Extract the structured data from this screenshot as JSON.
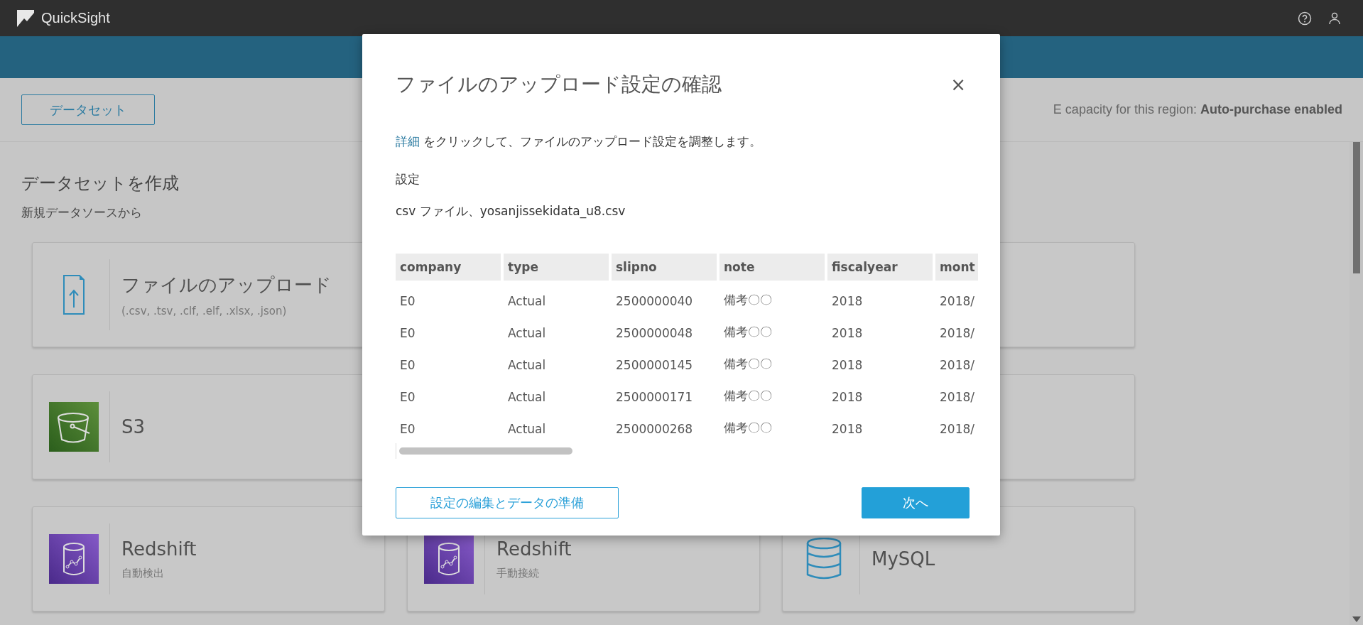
{
  "app": {
    "title": "QuickSight"
  },
  "toolbar": {
    "dataset_button": "データセット",
    "capacity_note": "E capacity for this region: **Auto-purchase enabled**"
  },
  "page": {
    "heading": "データセットを作成",
    "subheading": "新規データソースから"
  },
  "sources": [
    {
      "kind": "upload",
      "title": "ファイルのアップロード",
      "subtitle": "(.csv, .tsv, .clf, .elf, .xlsx, .json)"
    },
    {
      "kind": "covered"
    },
    {
      "kind": "blank"
    },
    {
      "kind": "s3",
      "title": "S3"
    },
    {
      "kind": "covered"
    },
    {
      "kind": "blank"
    },
    {
      "kind": "redshift",
      "title": "Redshift",
      "subtitle": "自動検出"
    },
    {
      "kind": "redshift",
      "title": "Redshift",
      "subtitle": "手動接続"
    },
    {
      "kind": "mysql",
      "title": "MySQL"
    }
  ],
  "dialog": {
    "title": "ファイルのアップロード設定の確認",
    "close": "×",
    "instruction_link": "詳細",
    "instruction": " をクリックして、ファイルのアップロード設定を調整します。",
    "settings_label": "設定",
    "settings_value": "csv ファイル、yosanjissekidata_u8.csv",
    "table": {
      "columns": [
        "company",
        "type",
        "slipno",
        "note",
        "fiscalyear",
        "mont"
      ],
      "rows": [
        [
          "E0",
          "Actual",
          "2500000040",
          "備考〇〇",
          "2018",
          "2018/"
        ],
        [
          "E0",
          "Actual",
          "2500000048",
          "備考〇〇",
          "2018",
          "2018/"
        ],
        [
          "E0",
          "Actual",
          "2500000145",
          "備考〇〇",
          "2018",
          "2018/"
        ],
        [
          "E0",
          "Actual",
          "2500000171",
          "備考〇〇",
          "2018",
          "2018/"
        ],
        [
          "E0",
          "Actual",
          "2500000268",
          "備考〇〇",
          "2018",
          "2018/"
        ]
      ]
    },
    "buttons": [
      {
        "kind": "secondary",
        "label": "設定の編集とデータの準備"
      },
      {
        "kind": "primary",
        "label": "次へ"
      }
    ]
  }
}
